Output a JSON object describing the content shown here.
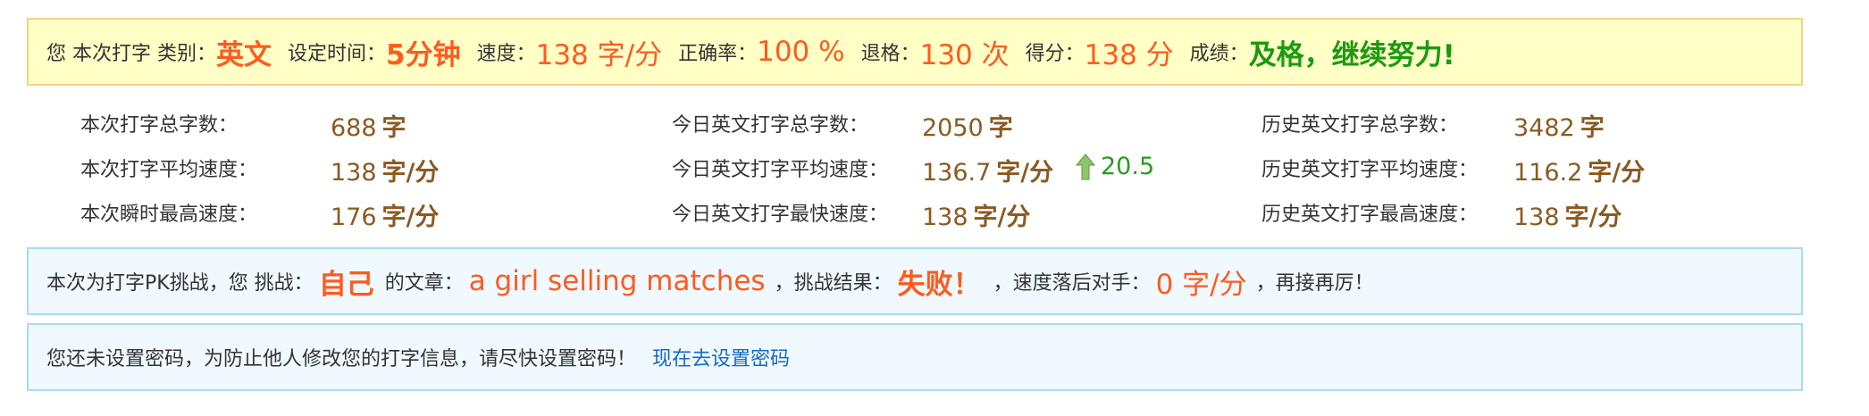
{
  "result_bar": {
    "category_label": "您 本次打字 类别：",
    "category_value": "英文",
    "time_label": "设定时间：",
    "time_value": "5分钟",
    "speed_label": "速度：",
    "speed_value": "138 字/分",
    "accuracy_label": "正确率：",
    "accuracy_value": "100 %",
    "backspace_label": "退格：",
    "backspace_value": "130 次",
    "score_label": "得分：",
    "score_value": "138 分",
    "grade_label": "成绩：",
    "grade_value": "及格，继续努力!"
  },
  "stats": {
    "session": [
      {
        "label": "本次打字总字数：",
        "num": "688",
        "unit": "字"
      },
      {
        "label": "本次打字平均速度：",
        "num": "138",
        "unit": "字/分"
      },
      {
        "label": "本次瞬时最高速度：",
        "num": "176",
        "unit": "字/分"
      }
    ],
    "today": [
      {
        "label": "今日英文打字总字数：",
        "num": "2050",
        "unit": "字"
      },
      {
        "label": "今日英文打字平均速度：",
        "num": "136.7",
        "unit": "字/分"
      },
      {
        "label": "今日英文打字最快速度：",
        "num": "138",
        "unit": "字/分"
      }
    ],
    "history": [
      {
        "label": "历史英文打字总字数：",
        "num": "3482",
        "unit": "字"
      },
      {
        "label": "历史英文打字平均速度：",
        "num": "116.2",
        "unit": "字/分"
      },
      {
        "label": "历史英文打字最高速度：",
        "num": "138",
        "unit": "字/分"
      }
    ],
    "today_avg_trend": {
      "direction": "up",
      "value": "20.5",
      "color": "#2a9c1e",
      "icon": "arrow-up-icon"
    }
  },
  "pk_box": {
    "intro": "本次为打字PK挑战，您 挑战：",
    "opponent": "自己",
    "article_label": "的文章：",
    "article": "a girl selling matches",
    "result_label": "，挑战结果：",
    "result": "失败！",
    "behind_label": "，速度落后对手：",
    "behind_value": "0 字/分",
    "tail": "，再接再厉！"
  },
  "password_box": {
    "message": "您还未设置密码，为防止他人修改您的打字信息，请尽快设置密码！",
    "link": "现在去设置密码"
  },
  "colors": {
    "highlight": "#ff5a1f",
    "grade": "#1a9a10",
    "stat_value": "#8b5a21",
    "link": "#1569c7"
  }
}
